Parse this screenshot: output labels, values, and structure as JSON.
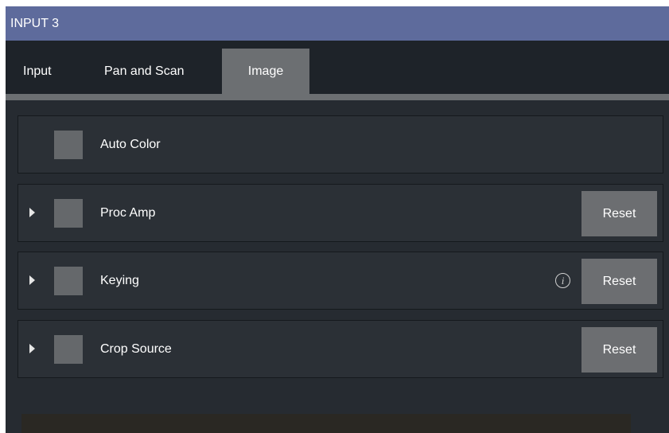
{
  "window": {
    "title": "INPUT 3"
  },
  "tabs": [
    {
      "label": "Input",
      "active": false
    },
    {
      "label": "Pan and Scan",
      "active": false
    },
    {
      "label": "Image",
      "active": true
    }
  ],
  "rows": [
    {
      "label": "Auto Color",
      "expandable": false,
      "checked": false,
      "reset_label": ""
    },
    {
      "label": "Proc Amp",
      "expandable": true,
      "checked": false,
      "reset_label": "Reset"
    },
    {
      "label": "Keying",
      "expandable": true,
      "checked": false,
      "reset_label": "Reset",
      "info_icon": "i"
    },
    {
      "label": "Crop Source",
      "expandable": true,
      "checked": false,
      "reset_label": "Reset"
    }
  ],
  "colors": {
    "titlebar": "#5e6b9c",
    "background": "#22272e",
    "active_tab": "#6c6f72",
    "button": "#6c6e71"
  }
}
